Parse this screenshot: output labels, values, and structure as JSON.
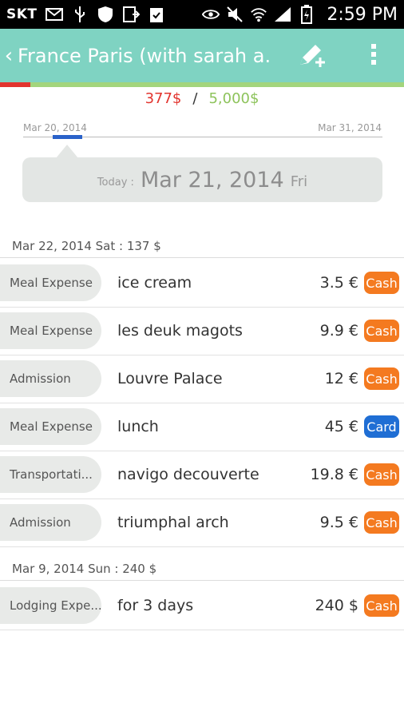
{
  "status_bar": {
    "carrier": "SKT",
    "clock": "2:59 PM",
    "icons_left": [
      "mail-icon",
      "usb-icon",
      "shield-icon",
      "download-icon",
      "clipboard-icon"
    ],
    "icons_right": [
      "eye-icon",
      "mute-icon",
      "wifi-icon",
      "signal-icon",
      "battery-icon"
    ]
  },
  "action_bar": {
    "back_glyph": "‹",
    "title": "France Paris (with sarah a...",
    "edit_icon": "edit-add-icon",
    "menu_icon": "overflow-menu-icon",
    "budget_used_fraction": 0.0754
  },
  "budget": {
    "spent": "377$",
    "separator": "/",
    "limit": "5,000$"
  },
  "date_range": {
    "start": "Mar 20, 2014",
    "end": "Mar 31, 2014"
  },
  "today": {
    "label": "Today :",
    "date": "Mar 21, 2014",
    "day": "Fri"
  },
  "groups": [
    {
      "header": "Mar 22, 2014 Sat  : 137 $",
      "items": [
        {
          "category": "Meal Expense",
          "description": "ice cream",
          "amount": "3.5 €",
          "payment": "Cash"
        },
        {
          "category": "Meal Expense",
          "description": "les deuk magots",
          "amount": "9.9 €",
          "payment": "Cash"
        },
        {
          "category": "Admission",
          "description": "Louvre Palace",
          "amount": "12 €",
          "payment": "Cash"
        },
        {
          "category": "Meal Expense",
          "description": "lunch",
          "amount": "45 €",
          "payment": "Card"
        },
        {
          "category": "Transportati...",
          "description": "navigo decouverte",
          "amount": "19.8 €",
          "payment": "Cash"
        },
        {
          "category": "Admission",
          "description": "triumphal arch",
          "amount": "9.5 €",
          "payment": "Cash"
        }
      ]
    },
    {
      "header": "Mar 9, 2014 Sun  : 240 $",
      "items": [
        {
          "category": "Lodging Expe...",
          "description": "for 3 days",
          "amount": "240 $",
          "payment": "Cash"
        }
      ]
    }
  ],
  "colors": {
    "action_bar": "#7fd3c2",
    "spent": "#e2342e",
    "limit": "#8dc35b",
    "cash": "#f47a20",
    "card": "#1f6ed4",
    "range_marker": "#2a62c9"
  }
}
